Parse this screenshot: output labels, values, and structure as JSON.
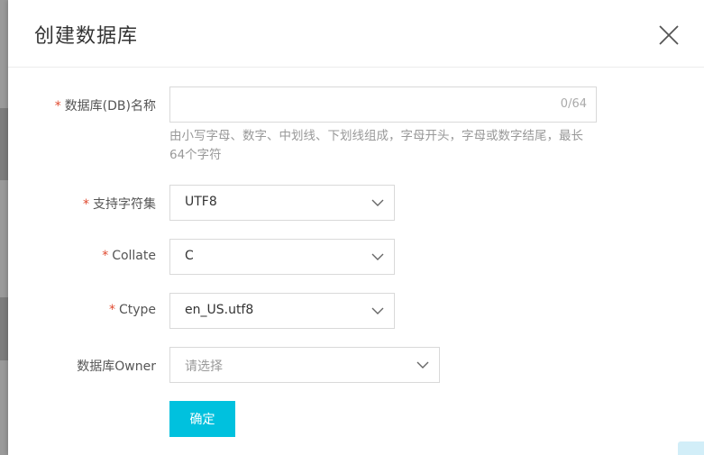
{
  "dialog": {
    "title": "创建数据库"
  },
  "form": {
    "db_name": {
      "label": "数据库(DB)名称",
      "required_mark": "*",
      "value": "",
      "counter": "0/64",
      "hint": "由小写字母、数字、中划线、下划线组成，字母开头，字母或数字结尾，最长64个字符"
    },
    "charset": {
      "label": "支持字符集",
      "required_mark": "*",
      "value": "UTF8"
    },
    "collate": {
      "label": "Collate",
      "required_mark": "*",
      "value": "C"
    },
    "ctype": {
      "label": "Ctype",
      "required_mark": "*",
      "value": "en_US.utf8"
    },
    "owner": {
      "label": "数据库Owner",
      "placeholder": "请选择"
    },
    "confirm_label": "确定"
  },
  "colors": {
    "accent": "#00c1de",
    "required": "#e04a2f"
  },
  "icons": {
    "close": "close-icon",
    "dropdown": "chevron-down-icon"
  }
}
